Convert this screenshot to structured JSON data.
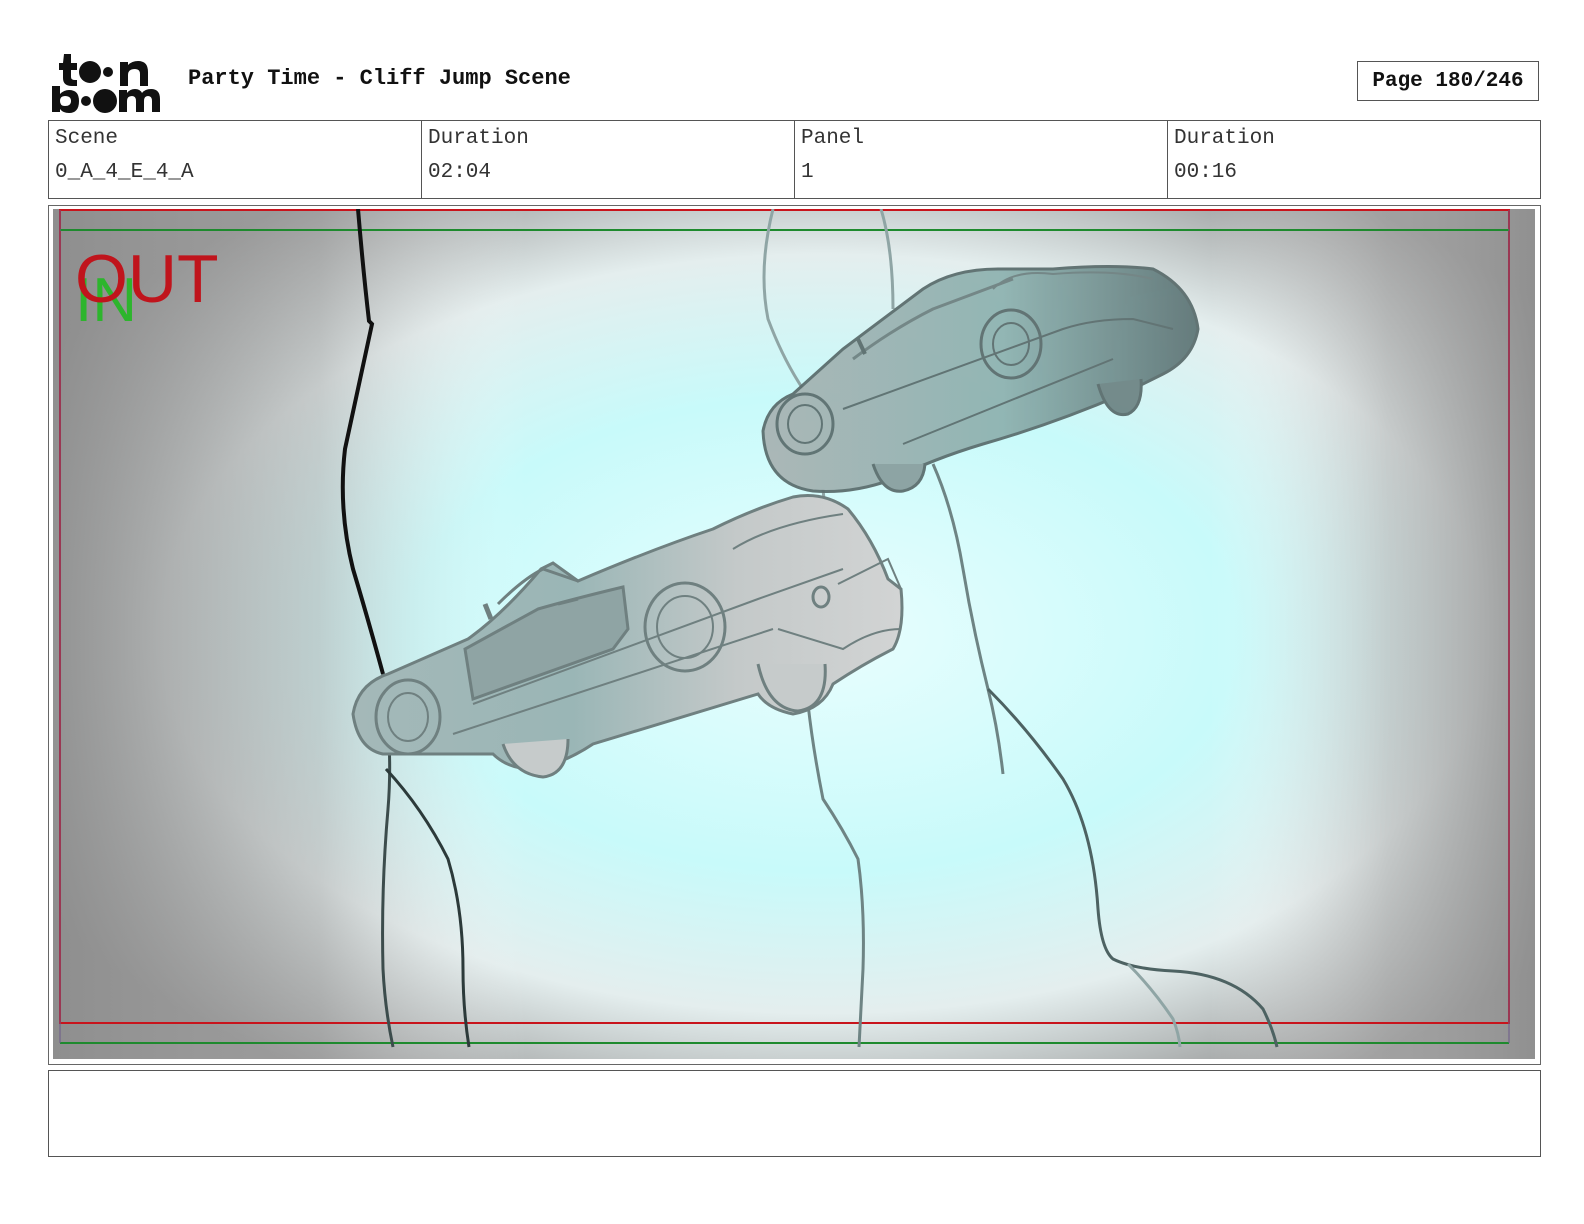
{
  "header": {
    "logo_text": "toon boom",
    "title": "Party Time - Cliff Jump Scene",
    "page_label": "Page 180/246"
  },
  "info": {
    "scene_label": "Scene",
    "scene_value": "0_A_4_E_4_A",
    "scene_duration_label": "Duration",
    "scene_duration_value": "02:04",
    "panel_label": "Panel",
    "panel_value": "1",
    "panel_duration_label": "Duration",
    "panel_duration_value": "00:16"
  },
  "panel": {
    "out_marker": "OUT",
    "in_marker": "IN",
    "colors": {
      "out_marker": "#c0141c",
      "in_marker": "#2db52d",
      "safe_frame_red": "#c8141c",
      "safe_frame_green": "#1e8a2e",
      "glow": "#c8fafa",
      "vignette": "#8e8e8e"
    }
  },
  "notes": {
    "text": ""
  }
}
